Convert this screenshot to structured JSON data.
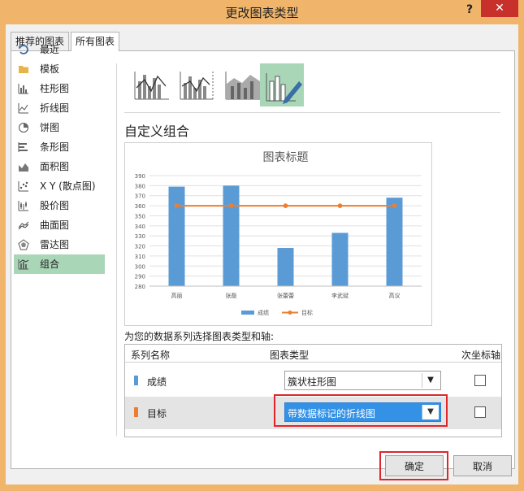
{
  "window": {
    "title": "更改图表类型",
    "help": "?",
    "close": "✕"
  },
  "tabs": [
    {
      "label": "推荐的图表"
    },
    {
      "label": "所有图表"
    }
  ],
  "nav": [
    {
      "label": "最近",
      "icon": "recent-icon"
    },
    {
      "label": "模板",
      "icon": "folder-icon"
    },
    {
      "label": "柱形图",
      "icon": "column-chart-icon"
    },
    {
      "label": "折线图",
      "icon": "line-chart-icon"
    },
    {
      "label": "饼图",
      "icon": "pie-chart-icon"
    },
    {
      "label": "条形图",
      "icon": "bar-chart-icon"
    },
    {
      "label": "面积图",
      "icon": "area-chart-icon"
    },
    {
      "label": "X Y (散点图)",
      "icon": "scatter-chart-icon"
    },
    {
      "label": "股价图",
      "icon": "stock-chart-icon"
    },
    {
      "label": "曲面图",
      "icon": "surface-chart-icon"
    },
    {
      "label": "雷达图",
      "icon": "radar-chart-icon"
    },
    {
      "label": "组合",
      "icon": "combo-chart-icon",
      "selected": true
    }
  ],
  "section_heading": "自定义组合",
  "chart_data": {
    "type": "bar",
    "title": "图表标题",
    "categories": [
      "高丽",
      "张磊",
      "张蕾蕾",
      "李武斌",
      "高议"
    ],
    "series": [
      {
        "name": "成绩",
        "type": "bar",
        "color": "#5b9bd5",
        "values": [
          379,
          380,
          318,
          333,
          368
        ]
      },
      {
        "name": "目标",
        "type": "line",
        "color": "#ed7d31",
        "values": [
          360,
          360,
          360,
          360,
          360
        ]
      }
    ],
    "ylim": [
      280,
      390
    ],
    "yticks": [
      280,
      290,
      300,
      310,
      320,
      330,
      340,
      350,
      360,
      370,
      380,
      390
    ],
    "grid": true,
    "legend": "bottom"
  },
  "series_prompt": "为您的数据系列选择图表类型和轴:",
  "grid": {
    "headers": {
      "name": "系列名称",
      "type": "图表类型",
      "axis": "次坐标轴"
    },
    "rows": [
      {
        "name": "成绩",
        "color": "#5b9bd5",
        "type": "簇状柱形图",
        "secondary": false
      },
      {
        "name": "目标",
        "color": "#ed7d31",
        "type": "带数据标记的折线图",
        "secondary": false
      }
    ]
  },
  "buttons": {
    "ok": "确定",
    "cancel": "取消"
  },
  "colors": {
    "accent": "#a9d6b7",
    "highlight": "#e0262b"
  }
}
